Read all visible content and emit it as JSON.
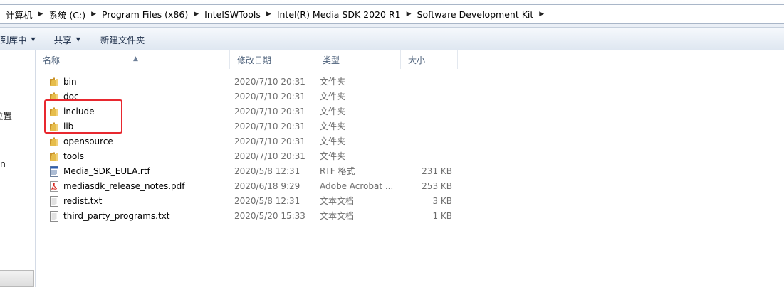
{
  "breadcrumb": [
    "计算机",
    "系统 (C:)",
    "Program Files (x86)",
    "IntelSWTools",
    "Intel(R) Media SDK 2020 R1",
    "Software Development Kit"
  ],
  "toolbar": {
    "include_library": "到库中",
    "share": "共享",
    "new_folder": "新建文件夹"
  },
  "nav": {
    "item1": "位置",
    "item2": "n"
  },
  "columns": {
    "name": "名称",
    "date": "修改日期",
    "type": "类型",
    "size": "大小"
  },
  "files": [
    {
      "name": "bin",
      "date": "2020/7/10 20:31",
      "type": "文件夹",
      "size": "",
      "icon": "folder-icon"
    },
    {
      "name": "doc",
      "date": "2020/7/10 20:31",
      "type": "文件夹",
      "size": "",
      "icon": "folder-icon"
    },
    {
      "name": "include",
      "date": "2020/7/10 20:31",
      "type": "文件夹",
      "size": "",
      "icon": "folder-icon"
    },
    {
      "name": "lib",
      "date": "2020/7/10 20:31",
      "type": "文件夹",
      "size": "",
      "icon": "folder-icon"
    },
    {
      "name": "opensource",
      "date": "2020/7/10 20:31",
      "type": "文件夹",
      "size": "",
      "icon": "folder-icon"
    },
    {
      "name": "tools",
      "date": "2020/7/10 20:31",
      "type": "文件夹",
      "size": "",
      "icon": "folder-icon"
    },
    {
      "name": "Media_SDK_EULA.rtf",
      "date": "2020/5/8 12:31",
      "type": "RTF 格式",
      "size": "231 KB",
      "icon": "rtf-document-icon"
    },
    {
      "name": "mediasdk_release_notes.pdf",
      "date": "2020/6/18 9:29",
      "type": "Adobe Acrobat ...",
      "size": "253 KB",
      "icon": "pdf-document-icon"
    },
    {
      "name": "redist.txt",
      "date": "2020/5/8 12:31",
      "type": "文本文档",
      "size": "3 KB",
      "icon": "text-document-icon"
    },
    {
      "name": "third_party_programs.txt",
      "date": "2020/5/20 15:33",
      "type": "文本文档",
      "size": "1 KB",
      "icon": "text-document-icon"
    }
  ],
  "colors": {
    "highlight": "#e8282f",
    "folder": "#e6bd4c"
  }
}
